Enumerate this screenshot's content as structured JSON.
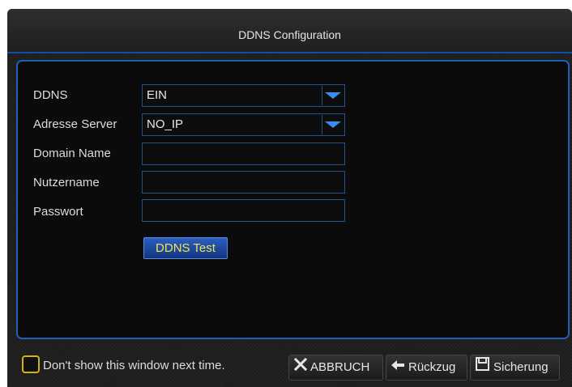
{
  "window": {
    "title": "DDNS Configuration"
  },
  "form": {
    "ddns": {
      "label": "DDNS",
      "value": "EIN"
    },
    "server": {
      "label": "Adresse Server",
      "value": "NO_IP"
    },
    "domain": {
      "label": "Domain Name",
      "value": ""
    },
    "user": {
      "label": "Nutzername",
      "value": ""
    },
    "password": {
      "label": "Passwort",
      "value": ""
    },
    "test_button": "DDNS Test"
  },
  "footer": {
    "checkbox_label": "Don't show this window next time.",
    "cancel_label": "ABBRUCH",
    "back_label": "Rückzug",
    "save_label": "Sicherung"
  },
  "colors": {
    "accent": "#1f5fb8",
    "button_text": "#f2e64a",
    "checkbox": "#d4b40b"
  }
}
